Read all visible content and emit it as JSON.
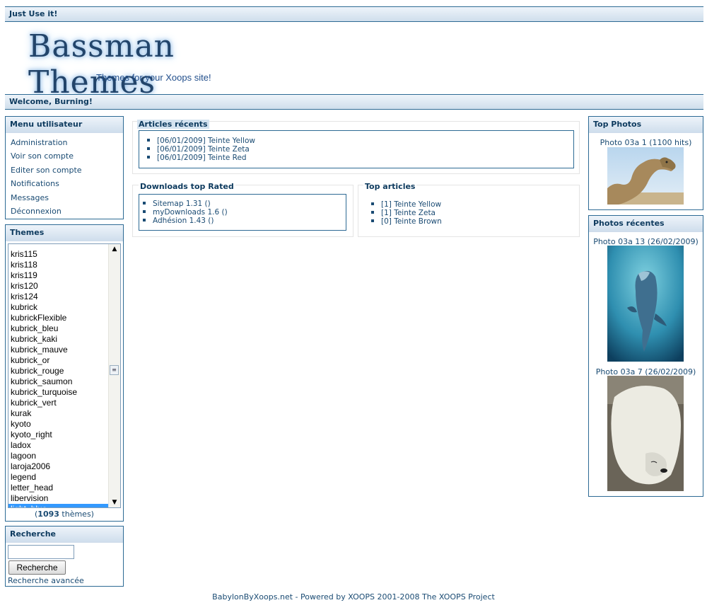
{
  "top_bar": {
    "text": "Just Use it!"
  },
  "logo": {
    "title": "Bassman Themes",
    "tagline": "Themes for your Xoops site!"
  },
  "welcome_bar": {
    "text": "Welcome, Burning!"
  },
  "user_menu": {
    "title": "Menu utilisateur",
    "items": [
      {
        "label": "Administration"
      },
      {
        "label": "Voir son compte"
      },
      {
        "label": "Editer son compte"
      },
      {
        "label": "Notifications"
      },
      {
        "label": "Messages"
      },
      {
        "label": "Déconnexion"
      }
    ]
  },
  "themes_block": {
    "title": "Themes",
    "items": [
      "kris115",
      "kris118",
      "kris119",
      "kris120",
      "kris124",
      "kubrick",
      "kubrickFlexible",
      "kubrick_bleu",
      "kubrick_kaki",
      "kubrick_mauve",
      "kubrick_or",
      "kubrick_rouge",
      "kubrick_saumon",
      "kubrick_turquoise",
      "kubrick_vert",
      "kurak",
      "kyoto",
      "kyoto_right",
      "ladox",
      "lagoon",
      "laroja2006",
      "legend",
      "letter_head",
      "libervision",
      "light_blue"
    ],
    "selected": "light_blue",
    "count": "1093",
    "count_suffix": " thèmes)",
    "count_prefix": "("
  },
  "search_block": {
    "title": "Recherche",
    "input_value": "",
    "button_label": "Recherche",
    "advanced_link": "Recherche avancée"
  },
  "recent_articles": {
    "title": "Articles récents",
    "items": [
      "[06/01/2009] Teinte Yellow",
      "[06/01/2009] Teinte Zeta",
      "[06/01/2009] Teinte Red"
    ]
  },
  "downloads_top_rated": {
    "title": "Downloads top Rated",
    "items": [
      "Sitemap 1.31 ()",
      "myDownloads 1.6 ()",
      "Adhésion 1.43 ()"
    ]
  },
  "top_articles": {
    "title": "Top articles",
    "items": [
      "[1] Teinte Yellow",
      "[1] Teinte Zeta",
      "[0] Teinte Brown"
    ]
  },
  "top_photos": {
    "title": "Top Photos",
    "caption": "Photo 03a 1 (1100 hits)"
  },
  "recent_photos": {
    "title": "Photos récentes",
    "photos": [
      {
        "caption": "Photo 03a 13 (26/02/2009)"
      },
      {
        "caption": "Photo 03a 7 (26/02/2009)"
      }
    ]
  },
  "footer": {
    "text": "BabylonByXoops.net - Powered by XOOPS 2001-2008 The XOOPS Project"
  },
  "colors": {
    "accent": "#2d6a94",
    "link": "#1a4b73",
    "header_gradient_top": "#eef4fa",
    "header_gradient_bottom": "#cfdeec",
    "selection": "#3399ff"
  }
}
